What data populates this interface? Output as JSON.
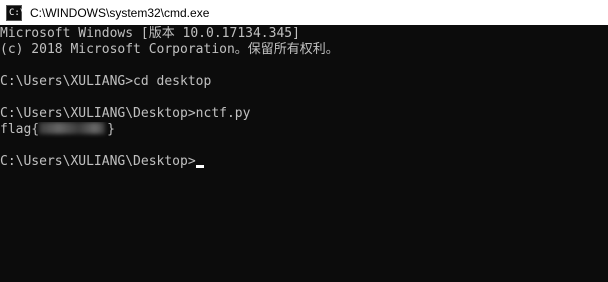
{
  "window": {
    "title": "C:\\WINDOWS\\system32\\cmd.exe",
    "icon": "cmd-icon",
    "prompt_glyph": "C:\\"
  },
  "console": {
    "lines": [
      "Microsoft Windows [版本 10.0.17134.345]",
      "(c) 2018 Microsoft Corporation。保留所有权利。",
      "",
      "C:\\Users\\XULIANG>cd desktop",
      "",
      "C:\\Users\\XULIANG\\Desktop>nctf.py",
      "",
      "",
      "C:\\Users\\XULIANG\\Desktop>"
    ],
    "flag_prefix": "flag{",
    "flag_suffix": "}"
  },
  "colors": {
    "background": "#0c0c0c",
    "text": "#c0c0c0",
    "titlebar": "#ffffff"
  }
}
